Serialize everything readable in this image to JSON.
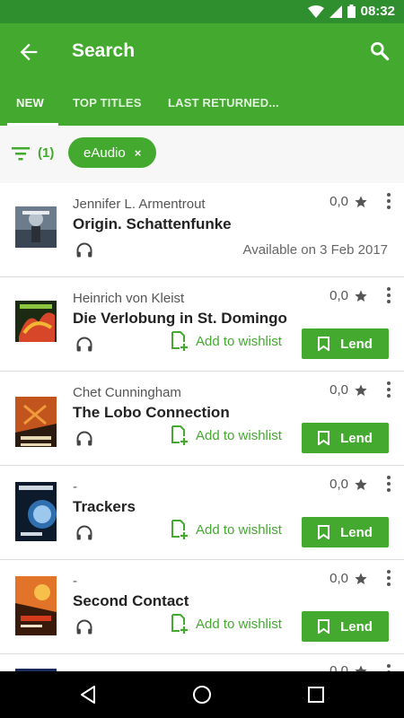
{
  "status": {
    "time": "08:32"
  },
  "appbar": {
    "title": "Search"
  },
  "tabs": [
    {
      "label": "NEW"
    },
    {
      "label": "TOP TITLES"
    },
    {
      "label": "LAST RETURNED..."
    }
  ],
  "filter": {
    "count": "(1)",
    "chip": "eAudio",
    "chip_close": "×"
  },
  "items": [
    {
      "author": "Jennifer L. Armentrout",
      "title": "Origin. Schattenfunke",
      "rating": "0,0",
      "available": "Available on 3 Feb 2017"
    },
    {
      "author": "Heinrich von Kleist",
      "title": "Die Verlobung in St. Domingo",
      "rating": "0,0",
      "wishlist": "Add to wishlist",
      "lend": "Lend"
    },
    {
      "author": "Chet Cunningham",
      "title": "The Lobo Connection",
      "rating": "0,0",
      "wishlist": "Add to wishlist",
      "lend": "Lend"
    },
    {
      "author": "-",
      "title": "Trackers",
      "rating": "0,0",
      "wishlist": "Add to wishlist",
      "lend": "Lend"
    },
    {
      "author": "-",
      "title": "Second Contact",
      "rating": "0,0",
      "wishlist": "Add to wishlist",
      "lend": "Lend"
    },
    {
      "rating": "0,0"
    }
  ],
  "colors": {
    "primary": "#43aa2f",
    "status_bar": "#2f8f2f"
  },
  "icons": [
    "back-arrow-icon",
    "search-icon",
    "filter-icon",
    "headphones-icon",
    "star-icon",
    "more-vert-icon",
    "add-to-wishlist-icon",
    "bookmark-icon",
    "nav-back-icon",
    "nav-home-icon",
    "nav-recents-icon"
  ]
}
